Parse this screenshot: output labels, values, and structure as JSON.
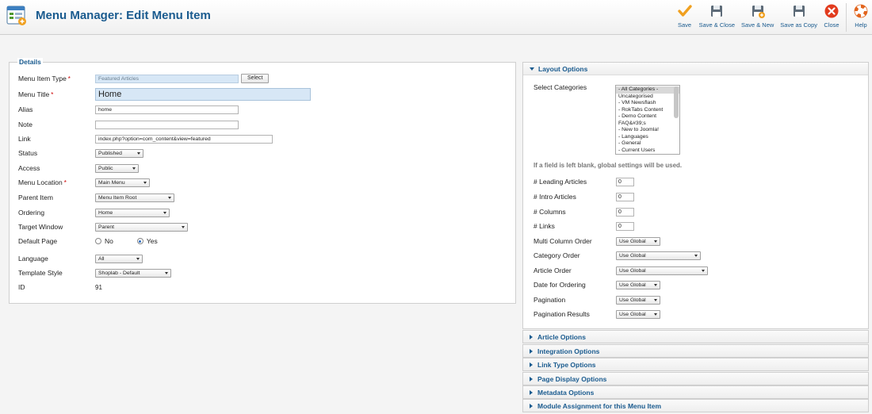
{
  "header": {
    "title": "Menu Manager: Edit Menu Item",
    "toolbar": {
      "save": "Save",
      "save_close": "Save & Close",
      "save_new": "Save & New",
      "save_copy": "Save as Copy",
      "close": "Close",
      "help": "Help"
    }
  },
  "details": {
    "legend": "Details",
    "required_mark": "*",
    "menu_item_type": {
      "label": "Menu Item Type",
      "value": "Featured Articles",
      "button": "Select"
    },
    "menu_title": {
      "label": "Menu Title",
      "value": "Home"
    },
    "alias": {
      "label": "Alias",
      "value": "home"
    },
    "note": {
      "label": "Note",
      "value": ""
    },
    "link": {
      "label": "Link",
      "value": "index.php?option=com_content&view=featured"
    },
    "status": {
      "label": "Status",
      "value": "Published"
    },
    "access": {
      "label": "Access",
      "value": "Public"
    },
    "menu_location": {
      "label": "Menu Location",
      "value": "Main Menu"
    },
    "parent_item": {
      "label": "Parent Item",
      "value": "Menu Item Root"
    },
    "ordering": {
      "label": "Ordering",
      "value": "Home"
    },
    "target_window": {
      "label": "Target Window",
      "value": "Parent"
    },
    "default_page": {
      "label": "Default Page",
      "no": "No",
      "yes": "Yes",
      "selected": "Yes"
    },
    "language": {
      "label": "Language",
      "value": "All"
    },
    "template_style": {
      "label": "Template Style",
      "value": "Shoplab - Default"
    },
    "id": {
      "label": "ID",
      "value": "91"
    }
  },
  "layout_options": {
    "title": "Layout Options",
    "select_categories": {
      "label": "Select Categories",
      "options": [
        "- All Categories -",
        "Uncategorised",
        "- VM Newsflash",
        "- RokTabs Content",
        "- Demo Content",
        "FAQ&#39;s",
        "- New to Joomla!",
        "- Languages",
        "- General",
        "- Current Users"
      ]
    },
    "note": "If a field is left blank, global settings will be used.",
    "leading_articles": {
      "label": "# Leading Articles",
      "value": "0"
    },
    "intro_articles": {
      "label": "# Intro Articles",
      "value": "0"
    },
    "columns": {
      "label": "# Columns",
      "value": "0"
    },
    "links": {
      "label": "# Links",
      "value": "0"
    },
    "multi_column_order": {
      "label": "Multi Column Order",
      "value": "Use Global"
    },
    "category_order": {
      "label": "Category Order",
      "value": "Use Global"
    },
    "article_order": {
      "label": "Article Order",
      "value": "Use Global"
    },
    "date_for_ordering": {
      "label": "Date for Ordering",
      "value": "Use Global"
    },
    "pagination": {
      "label": "Pagination",
      "value": "Use Global"
    },
    "pagination_results": {
      "label": "Pagination Results",
      "value": "Use Global"
    }
  },
  "panels": [
    "Article Options",
    "Integration Options",
    "Link Type Options",
    "Page Display Options",
    "Metadata Options",
    "Module Assignment for this Menu Item"
  ],
  "colors": {
    "accent": "#1a5b8f",
    "readonly_bg": "#d7e7f6",
    "close_red": "#e23b1e",
    "save_orange": "#f0a020"
  }
}
